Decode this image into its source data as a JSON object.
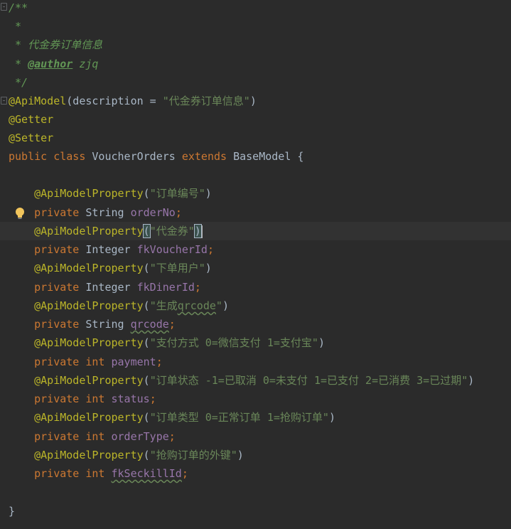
{
  "editor": {
    "doc": {
      "open": "/**",
      "star": " *",
      "desc": " * 代金券订单信息",
      "author_prefix": " * ",
      "author_tag": "@author",
      "author_name": " zjq",
      "close": " */"
    },
    "class_annotations": {
      "api_model": "@ApiModel",
      "api_model_args_open": "(description = ",
      "api_model_desc": "\"代金券订单信息\"",
      "api_model_args_close": ")",
      "getter": "@Getter",
      "setter": "@Setter"
    },
    "class_decl": {
      "kw_public": "public",
      "kw_class": "class",
      "name": "VoucherOrders",
      "kw_extends": "extends",
      "base": "BaseModel",
      "open_brace": "{",
      "close_brace": "}"
    },
    "property_annotation": "@ApiModelProperty",
    "kw_private": "private",
    "fields": [
      {
        "desc": "\"订单编号\"",
        "type": "String",
        "name": "orderNo"
      },
      {
        "desc": "\"代金券\"",
        "type": "Integer",
        "name": "fkVoucherId"
      },
      {
        "desc": "\"下单用户\"",
        "type": "Integer",
        "name": "fkDinerId"
      },
      {
        "desc_pre": "\"生成",
        "desc_wavy": "qrcode",
        "desc_post": "\"",
        "type": "String",
        "name": "qrcode"
      },
      {
        "desc": "\"支付方式 0=微信支付 1=支付宝\"",
        "type": "int",
        "name": "payment"
      },
      {
        "desc": "\"订单状态 -1=已取消 0=未支付 1=已支付 2=已消费 3=已过期\"",
        "type": "int",
        "name": "status"
      },
      {
        "desc": "\"订单类型 0=正常订单 1=抢购订单\"",
        "type": "int",
        "name": "orderType"
      },
      {
        "desc": "\"抢购订单的外键\"",
        "type": "int",
        "name": "fkSeckillId"
      }
    ],
    "semicolon": ";",
    "paren_open": "(",
    "paren_close": ")",
    "icons": {
      "fold": "fold-marker-icon",
      "intention": "lightbulb-icon"
    },
    "colors": {
      "background": "#2b2b2b",
      "current_line": "#323232",
      "keyword": "#cc7832",
      "annotation": "#bbb529",
      "string": "#6a8759",
      "field": "#9876aa",
      "doc_comment": "#629755",
      "text": "#a9b7c6"
    }
  }
}
